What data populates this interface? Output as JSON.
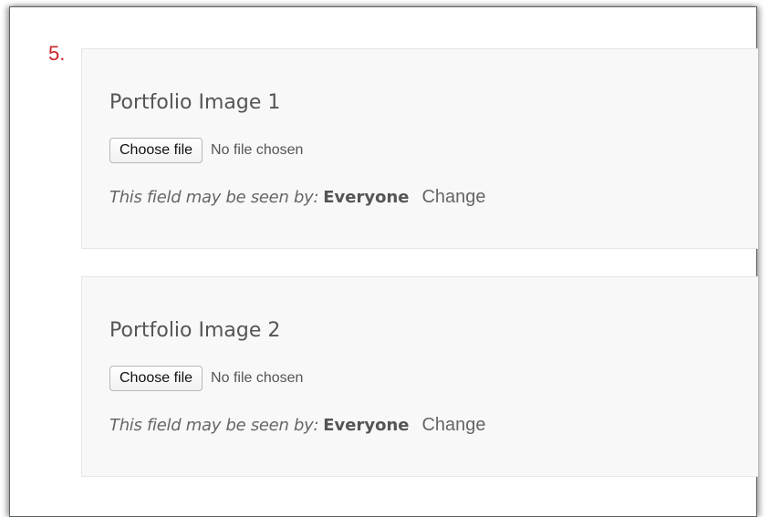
{
  "step": {
    "number": "5."
  },
  "fields": [
    {
      "title": "Portfolio Image 1",
      "choose_file_label": "Choose file",
      "file_status": "No file chosen",
      "visibility_label": "This field may be seen by:",
      "visibility_value": "Everyone",
      "change_label": "Change"
    },
    {
      "title": "Portfolio Image 2",
      "choose_file_label": "Choose file",
      "file_status": "No file chosen",
      "visibility_label": "This field may be seen by:",
      "visibility_value": "Everyone",
      "change_label": "Change"
    }
  ],
  "colors": {
    "step_number": "#c8262b",
    "card_background": "#f8f8f8",
    "text": "#555555"
  }
}
